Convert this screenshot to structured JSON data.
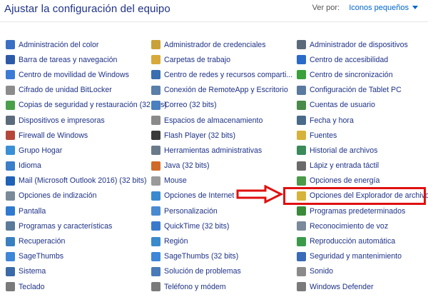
{
  "header": {
    "title": "Ajustar la configuración del equipo",
    "view_by_label": "Ver por:",
    "view_by_value": "Iconos pequeños"
  },
  "colors": {
    "link": "#1e3287",
    "dropdown": "#0066cc",
    "highlight": "#e01010"
  },
  "columns": [
    {
      "items": [
        {
          "label": "Administración del color",
          "icon": "color-management-icon",
          "color": "#3a6fc4"
        },
        {
          "label": "Barra de tareas y navegación",
          "icon": "taskbar-icon",
          "color": "#2d5aa8"
        },
        {
          "label": "Centro de movilidad de Windows",
          "icon": "mobility-center-icon",
          "color": "#3b7bd6"
        },
        {
          "label": "Cifrado de unidad BitLocker",
          "icon": "bitlocker-icon",
          "color": "#8c8c8c"
        },
        {
          "label": "Copias de seguridad y restauración (32 bits)",
          "icon": "backup-icon",
          "color": "#4aa04a"
        },
        {
          "label": "Dispositivos e impresoras",
          "icon": "printer-icon",
          "color": "#5b6b7b"
        },
        {
          "label": "Firewall de Windows",
          "icon": "firewall-icon",
          "color": "#b5473a"
        },
        {
          "label": "Grupo Hogar",
          "icon": "homegroup-icon",
          "color": "#3a8fd6"
        },
        {
          "label": "Idioma",
          "icon": "language-icon",
          "color": "#3a7fc8"
        },
        {
          "label": "Mail (Microsoft Outlook 2016) (32 bits)",
          "icon": "mail-icon",
          "color": "#1f62b8"
        },
        {
          "label": "Opciones de indización",
          "icon": "indexing-icon",
          "color": "#7a8a9a"
        },
        {
          "label": "Pantalla",
          "icon": "display-icon",
          "color": "#2f7ad0"
        },
        {
          "label": "Programas y características",
          "icon": "programs-icon",
          "color": "#5a7a9a"
        },
        {
          "label": "Recuperación",
          "icon": "recovery-icon",
          "color": "#3a80c0"
        },
        {
          "label": "SageThumbs",
          "icon": "sagethumbs-icon",
          "color": "#3d86d8"
        },
        {
          "label": "Sistema",
          "icon": "system-icon",
          "color": "#3b6aa8"
        },
        {
          "label": "Teclado",
          "icon": "keyboard-icon",
          "color": "#7a7a7a"
        }
      ]
    },
    {
      "items": [
        {
          "label": "Administrador de credenciales",
          "icon": "credential-manager-icon",
          "color": "#c9a13a"
        },
        {
          "label": "Carpetas de trabajo",
          "icon": "work-folders-icon",
          "color": "#d6a93a"
        },
        {
          "label": "Centro de redes y recursos comparti...",
          "icon": "network-center-icon",
          "color": "#3a6fb0"
        },
        {
          "label": "Conexión de RemoteApp y Escritorio",
          "icon": "remoteapp-icon",
          "color": "#5a7fa8"
        },
        {
          "label": "Correo (32 bits)",
          "icon": "mail-icon",
          "color": "#4a7fc0"
        },
        {
          "label": "Espacios de almacenamiento",
          "icon": "storage-icon",
          "color": "#8a8a8a"
        },
        {
          "label": "Flash Player (32 bits)",
          "icon": "flash-icon",
          "color": "#3a3a3a"
        },
        {
          "label": "Herramientas administrativas",
          "icon": "admin-tools-icon",
          "color": "#6a7a8a"
        },
        {
          "label": "Java (32 bits)",
          "icon": "java-icon",
          "color": "#d06a2a"
        },
        {
          "label": "Mouse",
          "icon": "mouse-icon",
          "color": "#9a9a9a"
        },
        {
          "label": "Opciones de Internet",
          "icon": "internet-icon",
          "color": "#3a8ad0"
        },
        {
          "label": "Personalización",
          "icon": "personalization-icon",
          "color": "#4a8ad0"
        },
        {
          "label": "QuickTime (32 bits)",
          "icon": "quicktime-icon",
          "color": "#3a7acc"
        },
        {
          "label": "Región",
          "icon": "region-icon",
          "color": "#3a8acc"
        },
        {
          "label": "SageThumbs (32 bits)",
          "icon": "sagethumbs-icon",
          "color": "#3d86d8"
        },
        {
          "label": "Solución de problemas",
          "icon": "troubleshoot-icon",
          "color": "#4a7ab8"
        },
        {
          "label": "Teléfono y módem",
          "icon": "phone-icon",
          "color": "#7a7a7a"
        }
      ]
    },
    {
      "items": [
        {
          "label": "Administrador de dispositivos",
          "icon": "device-manager-icon",
          "color": "#5a6a7a"
        },
        {
          "label": "Centro de accesibilidad",
          "icon": "accessibility-icon",
          "color": "#2a6ac8"
        },
        {
          "label": "Centro de sincronización",
          "icon": "sync-center-icon",
          "color": "#3aa03a"
        },
        {
          "label": "Configuración de Tablet PC",
          "icon": "tablet-icon",
          "color": "#5a7aa0"
        },
        {
          "label": "Cuentas de usuario",
          "icon": "user-accounts-icon",
          "color": "#4a8a4a"
        },
        {
          "label": "Fecha y hora",
          "icon": "clock-icon",
          "color": "#4a6a8a"
        },
        {
          "label": "Fuentes",
          "icon": "fonts-icon",
          "color": "#d6b23a"
        },
        {
          "label": "Historial de archivos",
          "icon": "file-history-icon",
          "color": "#3a8a5a"
        },
        {
          "label": "Lápiz y entrada táctil",
          "icon": "pen-icon",
          "color": "#6a6a6a"
        },
        {
          "label": "Opciones de energía",
          "icon": "power-icon",
          "color": "#4a9a4a"
        },
        {
          "label": "Opciones del Explorador de archivos",
          "icon": "folder-options-icon",
          "color": "#d6b33a"
        },
        {
          "label": "Programas predeterminados",
          "icon": "default-programs-icon",
          "color": "#3a8a3a"
        },
        {
          "label": "Reconocimiento de voz",
          "icon": "microphone-icon",
          "color": "#7a8a9a"
        },
        {
          "label": "Reproducción automática",
          "icon": "autoplay-icon",
          "color": "#3a9a4a"
        },
        {
          "label": "Seguridad y mantenimiento",
          "icon": "flag-icon",
          "color": "#3a6ab8"
        },
        {
          "label": "Sonido",
          "icon": "speaker-icon",
          "color": "#8a8a8a"
        },
        {
          "label": "Windows Defender",
          "icon": "defender-icon",
          "color": "#7a7a7a"
        }
      ]
    }
  ]
}
